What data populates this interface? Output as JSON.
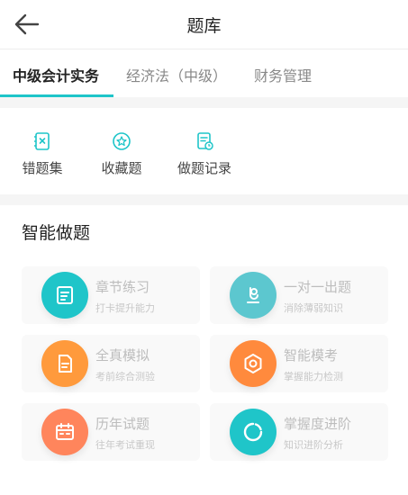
{
  "header": {
    "title": "题库"
  },
  "tabs": [
    {
      "label": "中级会计实务"
    },
    {
      "label": "经济法（中级）"
    },
    {
      "label": "财务管理"
    }
  ],
  "quick_actions": [
    {
      "label": "错题集",
      "icon": "error-book-icon"
    },
    {
      "label": "收藏题",
      "icon": "star-badge-icon"
    },
    {
      "label": "做题记录",
      "icon": "record-icon"
    }
  ],
  "section": {
    "title": "智能做题"
  },
  "cards": [
    {
      "name": "章节练习",
      "sub": "打卡提升能力",
      "icon": "chapter-practice-icon",
      "color": "#1fc5c9"
    },
    {
      "name": "一对一出题",
      "sub": "消除薄弱知识",
      "icon": "one-on-one-icon",
      "color": "#5cc7cf"
    },
    {
      "name": "全真模拟",
      "sub": "考前综合测验",
      "icon": "mock-exam-icon",
      "color": "#ff9a3c"
    },
    {
      "name": "智能模考",
      "sub": "掌握能力检测",
      "icon": "smart-exam-icon",
      "color": "#ff8a3d"
    },
    {
      "name": "历年试题",
      "sub": "往年考试重现",
      "icon": "past-papers-icon",
      "color": "#ff855c"
    },
    {
      "name": "掌握度进阶",
      "sub": "知识进阶分析",
      "icon": "mastery-icon",
      "color": "#1fc5c9"
    }
  ],
  "colors": {
    "accent": "#1fc5c9",
    "orange": "#ff9a3c"
  }
}
